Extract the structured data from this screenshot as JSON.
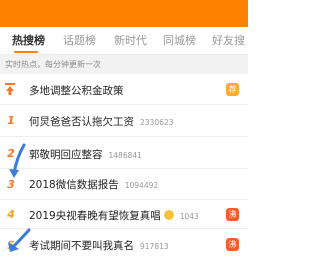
{
  "tabs": [
    {
      "label": "热搜榜",
      "active": true
    },
    {
      "label": "话题榜",
      "active": false
    },
    {
      "label": "新时代",
      "active": false
    },
    {
      "label": "同城榜",
      "active": false
    },
    {
      "label": "好友搜",
      "active": false
    }
  ],
  "subheader": "实时热点，每分钟更新一次",
  "list": [
    {
      "rank": "",
      "pinned": true,
      "title": "多地调整公积金政策",
      "count": "",
      "badge": "荐",
      "badge_color": "#ffab2d"
    },
    {
      "rank": "1",
      "pinned": false,
      "title": "何炅爸爸否认拖欠工资",
      "count": "2330623",
      "badge": "",
      "badge_color": ""
    },
    {
      "rank": "2",
      "pinned": false,
      "title": "郭敬明回应整容",
      "count": "1486841",
      "badge": "",
      "badge_color": ""
    },
    {
      "rank": "3",
      "pinned": false,
      "title": "2018微信数据报告",
      "count": "1094492",
      "badge": "",
      "badge_color": ""
    },
    {
      "rank": "4",
      "pinned": false,
      "title": "2019央视春晚有望恢复真唱",
      "count": "1043",
      "badge": "沸",
      "badge_color": "#ff5b29"
    },
    {
      "rank": "5",
      "pinned": false,
      "title": "考试期间不要叫我真名",
      "count": "917813",
      "badge": "沸",
      "badge_color": "#ff5b29"
    }
  ],
  "colors": {
    "brand": "#ff8200",
    "annotation_arrow": "#3d7bd9"
  },
  "icons": [
    "pin-icon",
    "smile-emoji-icon"
  ]
}
